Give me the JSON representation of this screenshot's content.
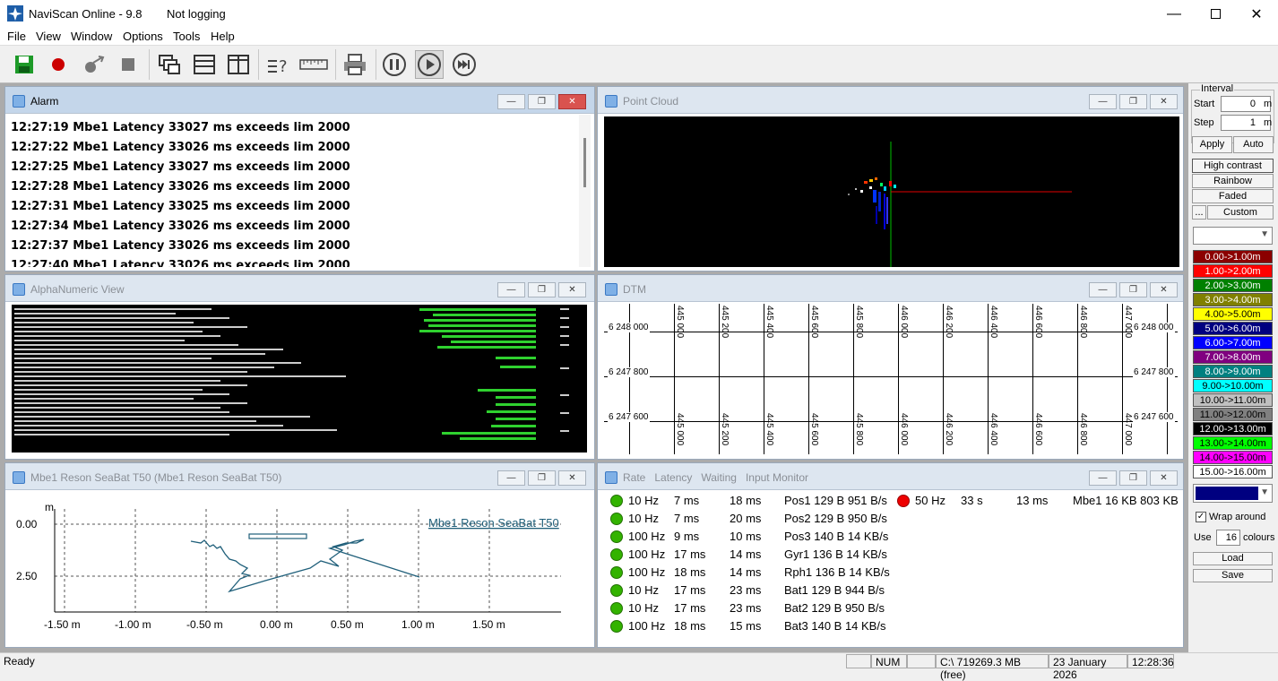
{
  "app": {
    "title": "NaviScan Online - 9.8",
    "logging_status": "Not logging"
  },
  "menu": [
    "File",
    "View",
    "Window",
    "Options",
    "Tools",
    "Help"
  ],
  "alarm": {
    "title": "Alarm",
    "lines": [
      "12:27:19 Mbe1 Latency 33027 ms exceeds lim 2000",
      "12:27:22 Mbe1 Latency 33026 ms exceeds lim 2000",
      "12:27:25 Mbe1 Latency 33027 ms exceeds lim 2000",
      "12:27:28 Mbe1 Latency 33026 ms exceeds lim 2000",
      "12:27:31 Mbe1 Latency 33025 ms exceeds lim 2000",
      "12:27:34 Mbe1 Latency 33026 ms exceeds lim 2000",
      "12:27:37 Mbe1 Latency 33026 ms exceeds lim 2000",
      "12:27:40 Mbe1 Latency 33026 ms exceeds lim 2000"
    ]
  },
  "point_cloud": {
    "title": "Point Cloud"
  },
  "alphanumeric": {
    "title": "AlphaNumeric View"
  },
  "dtm": {
    "title": "DTM",
    "easting_labels": [
      "445 000",
      "445 200",
      "445 400",
      "445 600",
      "445 800",
      "446 000",
      "446 200",
      "446 400",
      "446 600",
      "446 800",
      "447 000"
    ],
    "northing_labels": [
      "6 248 000",
      "6 247 800",
      "6 247 600"
    ]
  },
  "profile": {
    "title": "Mbe1 Reson SeaBat T50 (Mbe1 Reson SeaBat T50)",
    "legend": "Mbe1 Reson SeaBat T50",
    "y_unit": "m",
    "y_ticks": [
      "0.00",
      "2.50"
    ],
    "x_ticks": [
      "-1.50 m",
      "-1.00 m",
      "-0.50 m",
      "0.00 m",
      "0.50 m",
      "1.00 m",
      "1.50 m"
    ]
  },
  "monitor": {
    "title": "Rate   Latency   Waiting   Input Monitor",
    "rows": [
      {
        "rate": "10 Hz",
        "latency": "7 ms",
        "waiting": "18 ms",
        "input": "Pos1  129 B 951 B/s"
      },
      {
        "rate": "10 Hz",
        "latency": "7 ms",
        "waiting": "20 ms",
        "input": "Pos2  129 B 950 B/s"
      },
      {
        "rate": "100 Hz",
        "latency": "9 ms",
        "waiting": "10 ms",
        "input": "Pos3  140 B 14 KB/s"
      },
      {
        "rate": "100 Hz",
        "latency": "17 ms",
        "waiting": "14 ms",
        "input": "Gyr1  136 B 14 KB/s"
      },
      {
        "rate": "100 Hz",
        "latency": "18 ms",
        "waiting": "14 ms",
        "input": "Rph1  136 B 14 KB/s"
      },
      {
        "rate": "10 Hz",
        "latency": "17 ms",
        "waiting": "23 ms",
        "input": "Bat1  129 B 944 B/s"
      },
      {
        "rate": "10 Hz",
        "latency": "17 ms",
        "waiting": "23 ms",
        "input": "Bat2  129 B 950 B/s"
      },
      {
        "rate": "100 Hz",
        "latency": "18 ms",
        "waiting": "15 ms",
        "input": "Bat3  140 B 14 KB/s"
      }
    ],
    "right_row": {
      "rate": "50 Hz",
      "latency": "33 s",
      "waiting": "13 ms",
      "input": "Mbe1  16 KB 803 KB"
    }
  },
  "side": {
    "interval_label": "Interval",
    "start_label": "Start",
    "start_value": "0",
    "start_unit": "m",
    "step_label": "Step",
    "step_value": "1",
    "step_unit": "m",
    "apply": "Apply",
    "auto": "Auto",
    "high_contrast": "High contrast",
    "rainbow": "Rainbow",
    "faded": "Faded",
    "dots": "...",
    "custom": "Custom",
    "colours": [
      {
        "label": "0.00->1.00m",
        "bg": "#8b0000",
        "fg": "#ffffff"
      },
      {
        "label": "1.00->2.00m",
        "bg": "#ff0000",
        "fg": "#ffffff"
      },
      {
        "label": "2.00->3.00m",
        "bg": "#008000",
        "fg": "#ffffff"
      },
      {
        "label": "3.00->4.00m",
        "bg": "#808000",
        "fg": "#ffffff"
      },
      {
        "label": "4.00->5.00m",
        "bg": "#ffff00",
        "fg": "#000000"
      },
      {
        "label": "5.00->6.00m",
        "bg": "#000080",
        "fg": "#ffffff"
      },
      {
        "label": "6.00->7.00m",
        "bg": "#0000ff",
        "fg": "#ffffff"
      },
      {
        "label": "7.00->8.00m",
        "bg": "#800080",
        "fg": "#ffffff"
      },
      {
        "label": "8.00->9.00m",
        "bg": "#008080",
        "fg": "#ffffff"
      },
      {
        "label": "9.00->10.00m",
        "bg": "#00ffff",
        "fg": "#000000"
      },
      {
        "label": "10.00->11.00m",
        "bg": "#c0c0c0",
        "fg": "#000000"
      },
      {
        "label": "11.00->12.00m",
        "bg": "#808080",
        "fg": "#000000"
      },
      {
        "label": "12.00->13.00m",
        "bg": "#000000",
        "fg": "#ffffff"
      },
      {
        "label": "13.00->14.00m",
        "bg": "#00ff00",
        "fg": "#000000"
      },
      {
        "label": "14.00->15.00m",
        "bg": "#ff00ff",
        "fg": "#000000"
      },
      {
        "label": "15.00->16.00m",
        "bg": "#ffffff",
        "fg": "#000000"
      }
    ],
    "wrap_around": "Wrap around",
    "use_label": "Use",
    "use_value": "16",
    "colours_label": "colours",
    "load": "Load",
    "save": "Save"
  },
  "statusbar": {
    "ready": "Ready",
    "num": "NUM",
    "disk": "C:\\ 719269.3 MB (free)",
    "date": "23 January 2026",
    "time": "12:28:36"
  }
}
